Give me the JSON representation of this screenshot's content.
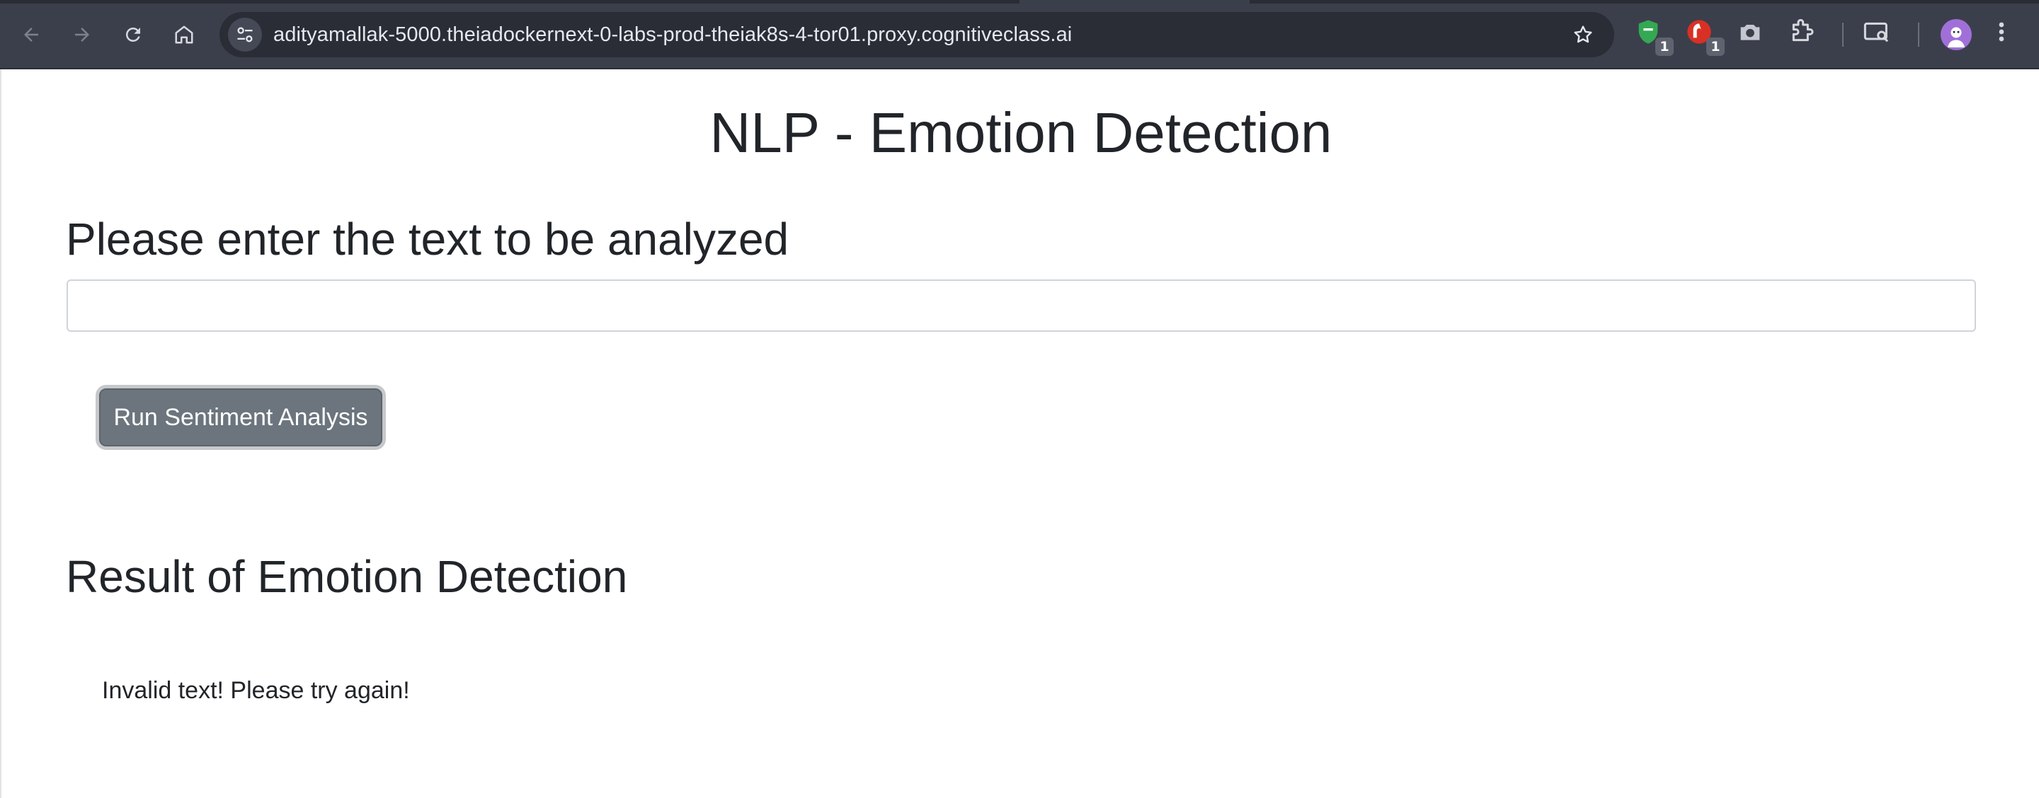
{
  "browser": {
    "url": "adityamallak-5000.theiadockernext-0-labs-prod-theiak8s-4-tor01.proxy.cognitiveclass.ai",
    "extensions": [
      {
        "icon": "shield-extension-icon",
        "badge": "1",
        "color": "#34a853"
      },
      {
        "icon": "red-extension-icon",
        "badge": "1",
        "color": "#d93025"
      }
    ],
    "colors": {
      "toolbar": "#3b3f4b",
      "omnibox": "#2a2d36",
      "avatar": "#a070d8"
    }
  },
  "page": {
    "title": "NLP - Emotion Detection",
    "prompt_heading": "Please enter the text to be analyzed",
    "input_value": "",
    "run_button_label": "Run Sentiment Analysis",
    "result_heading": "Result of Emotion Detection",
    "result_text": "Invalid text! Please try again!",
    "colors": {
      "button": "#6c757d",
      "text": "#212529",
      "input_border": "#ced4da"
    }
  }
}
